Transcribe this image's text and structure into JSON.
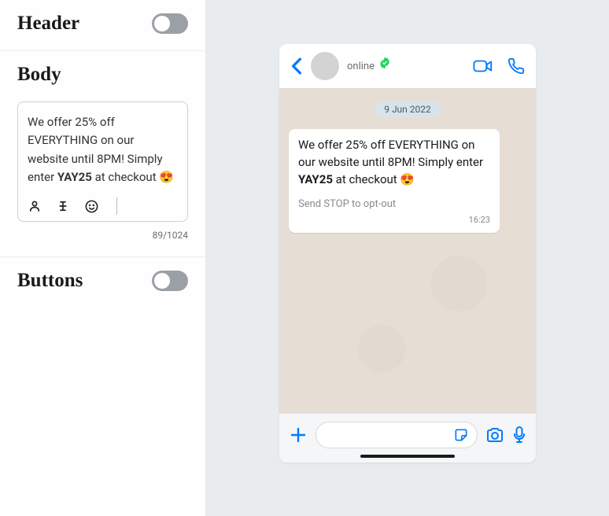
{
  "editor": {
    "header": {
      "title": "Header",
      "enabled": false
    },
    "body": {
      "title": "Body",
      "message_prefix": "We offer 25% off EVERYTHING on our website until 8PM! Simply enter ",
      "message_bold": "YAY25",
      "message_suffix": " at checkout 😍",
      "count": "89/1024"
    },
    "buttons": {
      "title": "Buttons",
      "enabled": false
    }
  },
  "preview": {
    "status": "online",
    "date_pill": "9 Jun 2022",
    "message_prefix": "We offer 25% off EVERYTHING on our website until 8PM! Simply enter ",
    "message_bold": "YAY25",
    "message_suffix": " at checkout 😍",
    "optout": "Send STOP to opt-out",
    "time": "16:23"
  }
}
